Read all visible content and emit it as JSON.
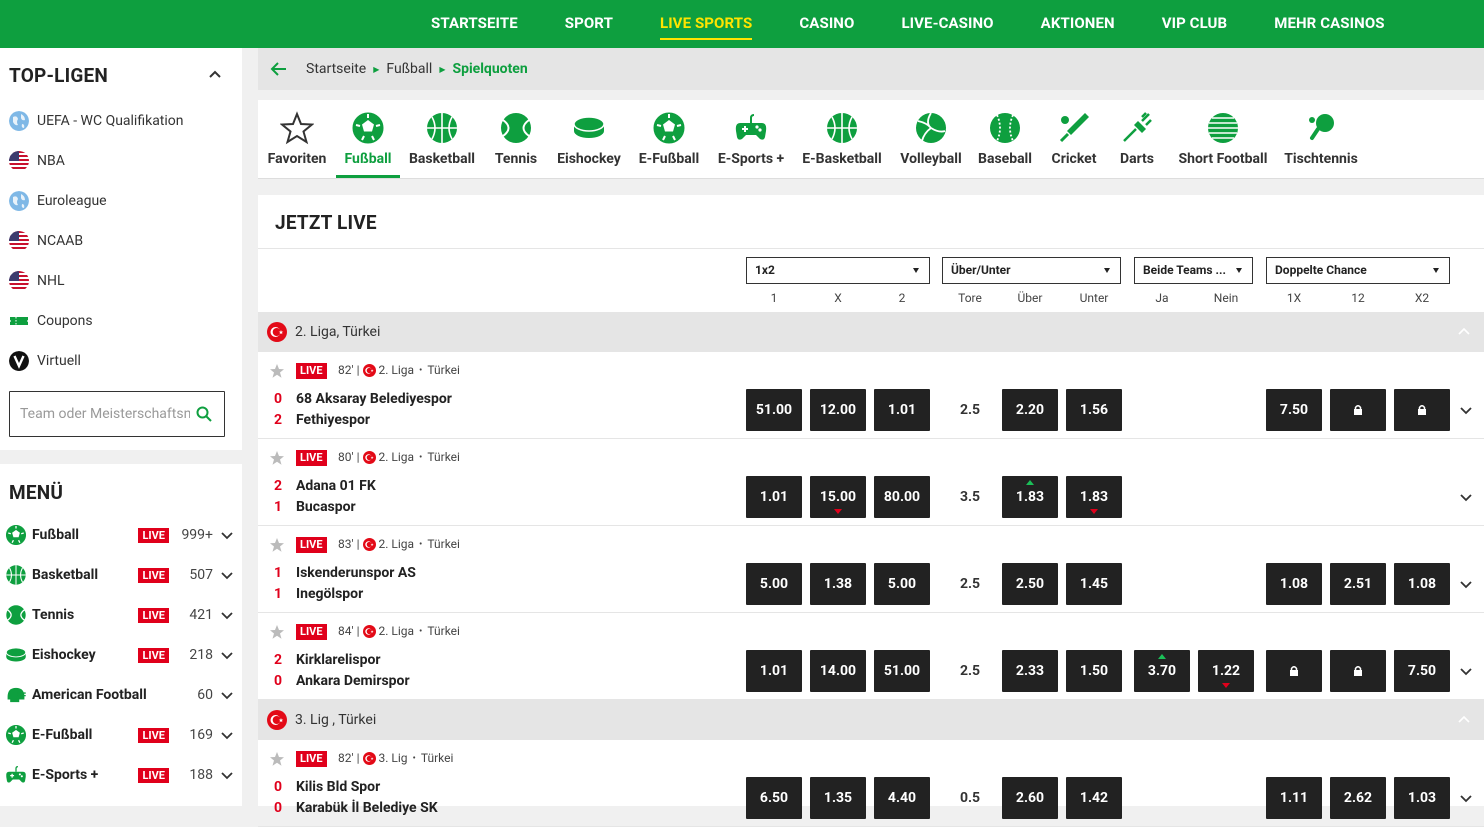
{
  "topnav": [
    "STARTSEITE",
    "SPORT",
    "LIVE SPORTS",
    "CASINO",
    "LIVE-CASINO",
    "AKTIONEN",
    "VIP CLUB",
    "MEHR CASINOS"
  ],
  "topnav_active_index": 2,
  "sidebar": {
    "top_title": "TOP-LIGEN",
    "top_items": [
      {
        "label": "UEFA - WC Qualifikation",
        "icon": "globe-icon"
      },
      {
        "label": "NBA",
        "icon": "us-flag-icon"
      },
      {
        "label": "Euroleague",
        "icon": "globe-icon"
      },
      {
        "label": "NCAAB",
        "icon": "us-flag-icon"
      },
      {
        "label": "NHL",
        "icon": "us-flag-icon"
      },
      {
        "label": "Coupons",
        "icon": "ticket-icon"
      },
      {
        "label": "Virtuell",
        "icon": "virtual-icon"
      }
    ],
    "search_placeholder": "Team oder Meisterschaftsname",
    "menu_title": "MENÜ",
    "menu_items": [
      {
        "label": "Fußball",
        "live": "LIVE",
        "count": "999+",
        "icon": "football-icon"
      },
      {
        "label": "Basketball",
        "live": "LIVE",
        "count": "507",
        "icon": "basketball-icon"
      },
      {
        "label": "Tennis",
        "live": "LIVE",
        "count": "421",
        "icon": "tennis-icon"
      },
      {
        "label": "Eishockey",
        "live": "LIVE",
        "count": "218",
        "icon": "hockey-puck-icon"
      },
      {
        "label": "American Football",
        "live": "",
        "count": "60",
        "icon": "american-football-icon"
      },
      {
        "label": "E-Fußball",
        "live": "LIVE",
        "count": "169",
        "icon": "football-icon"
      },
      {
        "label": "E-Sports +",
        "live": "LIVE",
        "count": "188",
        "icon": "gamepad-icon"
      }
    ]
  },
  "breadcrumb": [
    "Startseite",
    "Fußball",
    "Spielquoten"
  ],
  "sports_tabs": [
    {
      "label": "Favoriten",
      "icon": "star-icon"
    },
    {
      "label": "Fußball",
      "icon": "football-icon"
    },
    {
      "label": "Basketball",
      "icon": "basketball-icon"
    },
    {
      "label": "Tennis",
      "icon": "tennis-icon"
    },
    {
      "label": "Eishockey",
      "icon": "hockey-puck-icon"
    },
    {
      "label": "E-Fußball",
      "icon": "football-icon"
    },
    {
      "label": "E-Sports +",
      "icon": "gamepad-icon"
    },
    {
      "label": "E-Basketball",
      "icon": "basketball-icon"
    },
    {
      "label": "Volleyball",
      "icon": "volleyball-icon"
    },
    {
      "label": "Baseball",
      "icon": "baseball-icon"
    },
    {
      "label": "Cricket",
      "icon": "cricket-icon"
    },
    {
      "label": "Darts",
      "icon": "darts-icon"
    },
    {
      "label": "Short Football",
      "icon": "short-football-icon"
    },
    {
      "label": "Tischtennis",
      "icon": "table-tennis-icon"
    }
  ],
  "sports_active_index": 1,
  "live_title": "JETZT LIVE",
  "market_selects": [
    "1x2",
    "Über/Unter",
    "Beide Teams ...",
    "Doppelte Chance"
  ],
  "column_headers": [
    "1",
    "X",
    "2",
    "Tore",
    "Über",
    "Unter",
    "Ja",
    "Nein",
    "1X",
    "12",
    "X2"
  ],
  "leagues": [
    {
      "name": "2. Liga, Türkei"
    },
    {
      "name": "3. Lig , Türkei"
    }
  ],
  "matches": [
    {
      "live": "LIVE",
      "minute": "82'",
      "league": "2. Liga",
      "country": "Türkei",
      "home": "68 Aksaray Belediyespor",
      "away": "Fethiyespor",
      "score_home": "0",
      "score_away": "2",
      "odds_1x2": [
        "51.00",
        "12.00",
        "1.01"
      ],
      "tore": "2.5",
      "ou": [
        "2.20",
        "1.56"
      ],
      "btts": [
        "",
        ""
      ],
      "dc": [
        "7.50",
        "lock",
        "lock"
      ],
      "trend": {}
    },
    {
      "live": "LIVE",
      "minute": "80'",
      "league": "2. Liga",
      "country": "Türkei",
      "home": "Adana 01 FK",
      "away": "Bucaspor",
      "score_home": "2",
      "score_away": "1",
      "odds_1x2": [
        "1.01",
        "15.00",
        "80.00"
      ],
      "tore": "3.5",
      "ou": [
        "1.83",
        "1.83"
      ],
      "btts": [
        "",
        ""
      ],
      "dc": [
        "",
        "",
        ""
      ],
      "trend": {
        "x": "down",
        "over": "up",
        "under": "down"
      }
    },
    {
      "live": "LIVE",
      "minute": "83'",
      "league": "2. Liga",
      "country": "Türkei",
      "home": "Iskenderunspor AS",
      "away": "Inegölspor",
      "score_home": "1",
      "score_away": "1",
      "odds_1x2": [
        "5.00",
        "1.38",
        "5.00"
      ],
      "tore": "2.5",
      "ou": [
        "2.50",
        "1.45"
      ],
      "btts": [
        "",
        ""
      ],
      "dc": [
        "1.08",
        "2.51",
        "1.08"
      ],
      "trend": {}
    },
    {
      "live": "LIVE",
      "minute": "84'",
      "league": "2. Liga",
      "country": "Türkei",
      "home": "Kirklarelispor",
      "away": "Ankara Demirspor",
      "score_home": "2",
      "score_away": "0",
      "odds_1x2": [
        "1.01",
        "14.00",
        "51.00"
      ],
      "tore": "2.5",
      "ou": [
        "2.33",
        "1.50"
      ],
      "btts": [
        "3.70",
        "1.22"
      ],
      "dc": [
        "lock",
        "lock",
        "7.50"
      ],
      "trend": {
        "ja": "up",
        "nein": "down"
      }
    },
    {
      "live": "LIVE",
      "minute": "82'",
      "league": "3. Lig",
      "country": "Türkei",
      "home": "Kilis Bld Spor",
      "away": "Karabük İl Belediye SK",
      "score_home": "0",
      "score_away": "0",
      "odds_1x2": [
        "6.50",
        "1.35",
        "4.40"
      ],
      "tore": "0.5",
      "ou": [
        "2.60",
        "1.42"
      ],
      "btts": [
        "",
        ""
      ],
      "dc": [
        "1.11",
        "2.62",
        "1.03"
      ],
      "trend": {}
    }
  ],
  "colors": {
    "brand_green": "#0e9f3f",
    "live_red": "#e0001b",
    "odds_bg": "#222222",
    "active_yellow": "#ffe400"
  }
}
